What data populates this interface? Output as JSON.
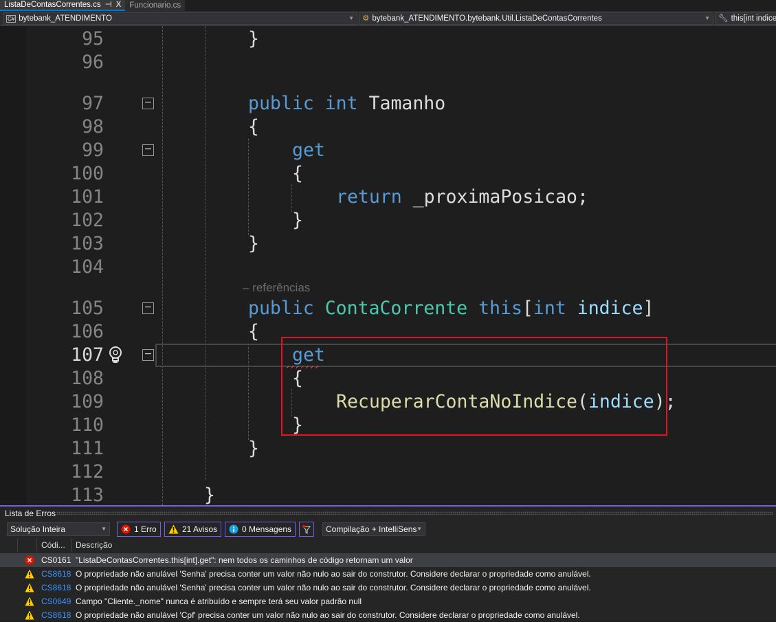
{
  "tabs": [
    {
      "label": "ListaDeContasCorrentes.cs",
      "active": true,
      "pin": "⊣",
      "close": "X"
    },
    {
      "label": "Funcionario.cs",
      "active": false
    }
  ],
  "nav": {
    "project": "bytebank_ATENDIMENTO",
    "type": "bytebank_ATENDIMENTO.bytebank.Util.ListaDeContasCorrentes",
    "member": "this[int indice]"
  },
  "editor": {
    "current_line": 107,
    "lines": [
      {
        "n": "95",
        "indent": 2,
        "tokens": [
          [
            "pl",
            "}"
          ]
        ]
      },
      {
        "n": "96",
        "indent": 0,
        "tokens": []
      },
      {
        "n": "97",
        "indent": 2,
        "lens": "",
        "fold": true,
        "tokens": [
          [
            "kw",
            "public"
          ],
          [
            "pl",
            " "
          ],
          [
            "kw",
            "int"
          ],
          [
            "pl",
            " Tamanho"
          ]
        ]
      },
      {
        "n": "98",
        "indent": 2,
        "tokens": [
          [
            "pl",
            "{"
          ]
        ]
      },
      {
        "n": "99",
        "indent": 3,
        "fold": true,
        "tokens": [
          [
            "kw",
            "get"
          ]
        ]
      },
      {
        "n": "100",
        "indent": 3,
        "tokens": [
          [
            "pl",
            "{"
          ]
        ]
      },
      {
        "n": "101",
        "indent": 4,
        "tokens": [
          [
            "kw",
            "return"
          ],
          [
            "pl",
            " _proximaPosicao;"
          ]
        ]
      },
      {
        "n": "102",
        "indent": 3,
        "tokens": [
          [
            "pl",
            "}"
          ]
        ]
      },
      {
        "n": "103",
        "indent": 2,
        "tokens": [
          [
            "pl",
            "}"
          ]
        ]
      },
      {
        "n": "104",
        "indent": 0,
        "tokens": []
      },
      {
        "n": "105",
        "indent": 2,
        "lens": "– referências",
        "fold": true,
        "tokens": [
          [
            "kw",
            "public"
          ],
          [
            "pl",
            " "
          ],
          [
            "ty",
            "ContaCorrente"
          ],
          [
            "pl",
            " "
          ],
          [
            "kw",
            "this"
          ],
          [
            "pl",
            "["
          ],
          [
            "kw",
            "int"
          ],
          [
            "pl",
            " "
          ],
          [
            "pa",
            "indice"
          ],
          [
            "pl",
            "]"
          ]
        ]
      },
      {
        "n": "106",
        "indent": 2,
        "tokens": [
          [
            "pl",
            "{"
          ]
        ]
      },
      {
        "n": "107",
        "indent": 3,
        "fold": true,
        "tokens": [
          [
            "kw",
            "get"
          ]
        ]
      },
      {
        "n": "108",
        "indent": 3,
        "tokens": [
          [
            "pl",
            "{"
          ]
        ]
      },
      {
        "n": "109",
        "indent": 4,
        "tokens": [
          [
            "me",
            "RecuperarContaNoIndice"
          ],
          [
            "pl",
            "("
          ],
          [
            "pa",
            "indice"
          ],
          [
            "pl",
            ");"
          ]
        ]
      },
      {
        "n": "110",
        "indent": 3,
        "tokens": [
          [
            "pl",
            "}"
          ]
        ]
      },
      {
        "n": "111",
        "indent": 2,
        "tokens": [
          [
            "pl",
            "}"
          ]
        ]
      },
      {
        "n": "112",
        "indent": 0,
        "tokens": []
      },
      {
        "n": "113",
        "indent": 1,
        "tokens": [
          [
            "pl",
            "}"
          ]
        ]
      }
    ],
    "highlight_color": "#e81123",
    "colors": {
      "keyword": "#569cd6",
      "type": "#4ec9b0",
      "method": "#dcdcaa",
      "param": "#9cdcfe"
    }
  },
  "error_list": {
    "title": "Lista de Erros",
    "scope": "Solução Inteira",
    "errors_btn": "1 Erro",
    "warnings_btn": "21 Avisos",
    "messages_btn": "0 Mensagens",
    "source": "Compilação + IntelliSens",
    "col_code": "Códi...",
    "col_desc": "Descrição",
    "rows": [
      {
        "severity": "error",
        "code": "CS0161",
        "desc": "\"ListaDeContasCorrentes.this[int].get\": nem todos os caminhos de código retornam um valor"
      },
      {
        "severity": "warning",
        "code": "CS8618",
        "desc": "O propriedade não anulável 'Senha' precisa conter um valor não nulo ao sair do construtor. Considere declarar o propriedade como anulável."
      },
      {
        "severity": "warning",
        "code": "CS8618",
        "desc": "O propriedade não anulável 'Senha' precisa conter um valor não nulo ao sair do construtor. Considere declarar o propriedade como anulável."
      },
      {
        "severity": "warning",
        "code": "CS0649",
        "desc": "Campo \"Cliente._nome\" nunca é atribuído e sempre terá seu valor padrão null"
      },
      {
        "severity": "warning",
        "code": "CS8618",
        "desc": "O propriedade não anulável 'Cpf' precisa conter um valor não nulo ao sair do construtor. Considere declarar o propriedade como anulável."
      }
    ]
  }
}
